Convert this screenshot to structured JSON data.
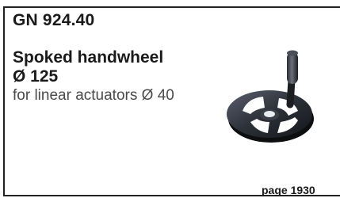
{
  "product": {
    "code": "GN 924.40",
    "name_line1": "Spoked handwheel",
    "name_line2": "Ø 125",
    "subtitle": "for linear actuators Ø 40",
    "page_ref": "page 1930"
  }
}
